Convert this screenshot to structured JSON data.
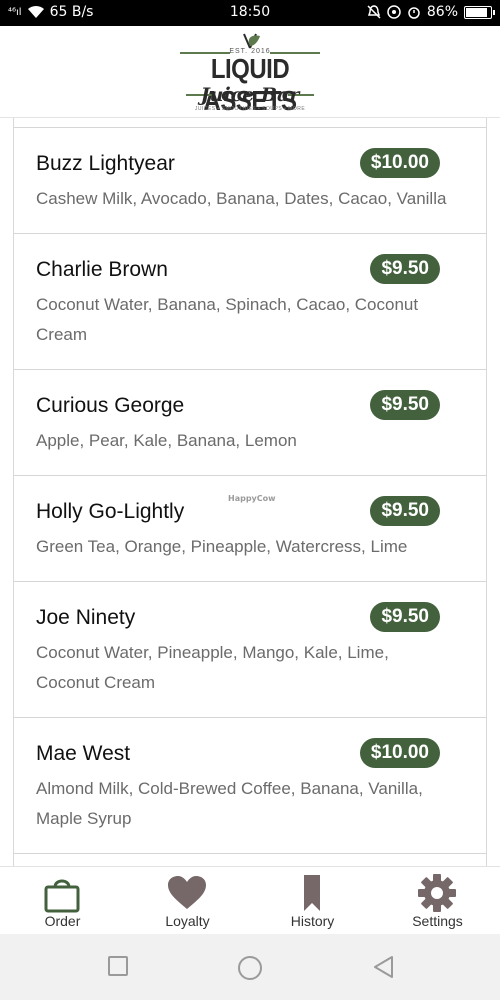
{
  "status_bar": {
    "signal": "⁴⁶ıl",
    "network_speed": "65 B/s",
    "time": "18:50",
    "battery_percent": "86%",
    "battery_level": 0.86
  },
  "header": {
    "brand_est": "EST. 2016",
    "brand_name": "LIQUID ASSETS",
    "brand_sub": "Juice Bar",
    "brand_tagline": "JUICES • SMOOTHIES • SOUPS • MORE"
  },
  "menu": {
    "items": [
      {
        "name": "",
        "price": "",
        "description": ""
      },
      {
        "name": "Buzz Lightyear",
        "price": "$10.00",
        "description": "Cashew Milk, Avocado, Banana, Dates, Cacao, Vanilla"
      },
      {
        "name": "Charlie Brown",
        "price": "$9.50",
        "description": "Coconut Water, Banana, Spinach, Cacao, Coconut Cream"
      },
      {
        "name": "Curious George",
        "price": "$9.50",
        "description": "Apple, Pear, Kale, Banana, Lemon"
      },
      {
        "name": "Holly Go-Lightly",
        "price": "$9.50",
        "description": "Green Tea, Orange, Pineapple, Watercress, Lime"
      },
      {
        "name": "Joe Ninety",
        "price": "$9.50",
        "description": "Coconut Water, Pineapple, Mango, Kale, Lime, Coconut Cream"
      },
      {
        "name": "Mae West",
        "price": "$10.00",
        "description": "Almond Milk, Cold-Brewed Coffee, Banana, Vanilla, Maple Syrup"
      }
    ]
  },
  "watermark": "HappyCow",
  "bottom_nav": {
    "items": [
      {
        "label": "Order",
        "icon": "shopping-bag-icon"
      },
      {
        "label": "Loyalty",
        "icon": "heart-icon"
      },
      {
        "label": "History",
        "icon": "bookmark-icon"
      },
      {
        "label": "Settings",
        "icon": "gear-icon"
      }
    ]
  },
  "colors": {
    "accent": "#43613d",
    "icon_gray": "#766868"
  }
}
